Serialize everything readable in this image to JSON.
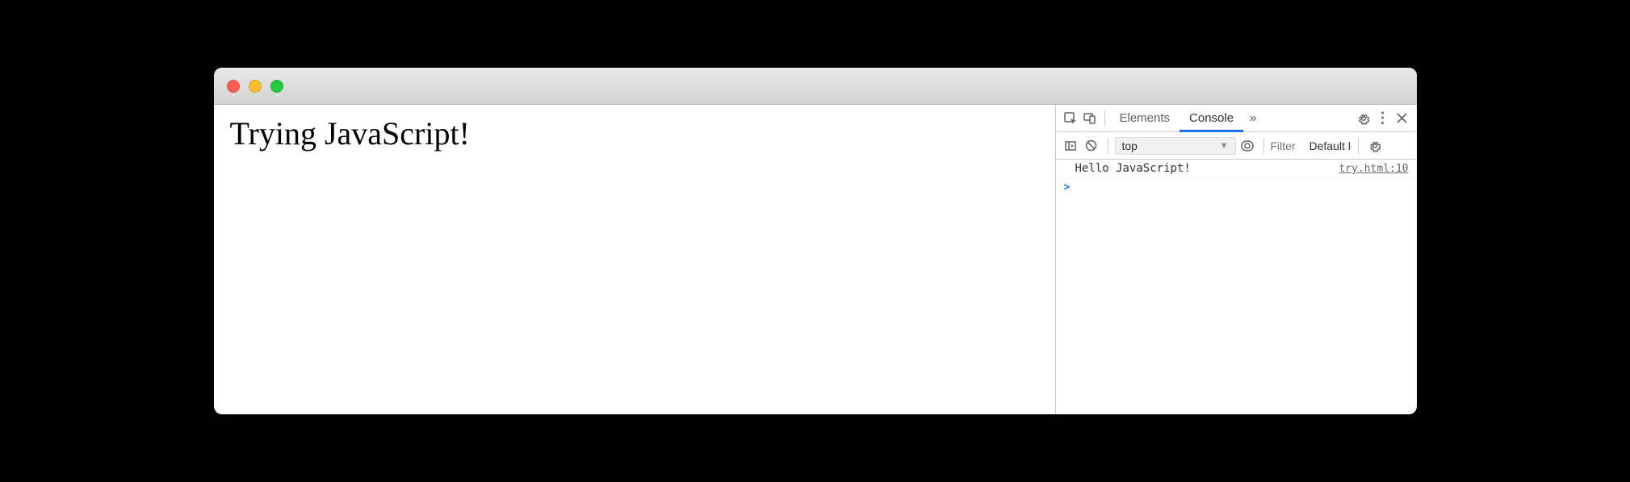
{
  "page": {
    "heading": "Trying JavaScript!"
  },
  "devtools": {
    "tabs": {
      "elements": "Elements",
      "console": "Console"
    },
    "toolbar": {
      "context": "top",
      "filter_placeholder": "Filter",
      "levels": "Default levels"
    },
    "console": {
      "log_message": "Hello JavaScript!",
      "log_source": "try.html:10",
      "prompt_caret": ">"
    }
  }
}
